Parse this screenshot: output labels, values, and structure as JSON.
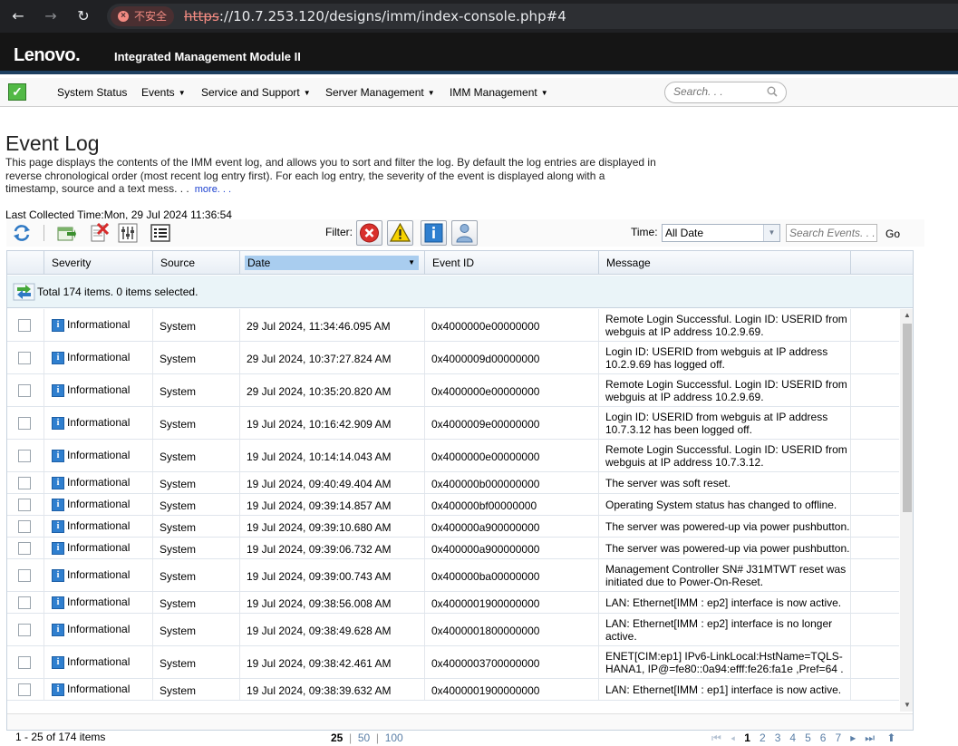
{
  "browser": {
    "insecure_label": "不安全",
    "url_scheme": "https",
    "url_rest": "://10.7.253.120/designs/imm/index-console.php#4"
  },
  "header": {
    "logo": "Lenovo.",
    "product": "Integrated Management Module II"
  },
  "menu": {
    "items": [
      "System Status",
      "Events",
      "Service and Support",
      "Server Management",
      "IMM Management"
    ],
    "search_placeholder": "Search. . ."
  },
  "page": {
    "title": "Event Log",
    "description": "This page displays the contents of the IMM event log, and allows you to sort and filter the log. By default the log entries are displayed in reverse chronological order (most recent log entry first). For each log entry, the severity of the event is displayed along with a timestamp, source and a text mess. . .",
    "more_link": "more. . .",
    "last_collected": "Last Collected Time:Mon, 29 Jul 2024 11:36:54"
  },
  "toolbar": {
    "filter_label": "Filter:",
    "time_label": "Time:",
    "time_value": "All Date",
    "search_events_placeholder": "Search Events. . .",
    "go_label": "Go"
  },
  "grid": {
    "columns": [
      "Severity",
      "Source",
      "Date",
      "Event ID",
      "Message"
    ],
    "sorted_column": "Date",
    "total_text": "Total 174 items. 0 items selected.",
    "rows": [
      {
        "severity": "Informational",
        "source": "System",
        "date": "29 Jul 2024, 11:34:46.095 AM",
        "event_id": "0x4000000e00000000",
        "message": "Remote Login Successful. Login ID: USERID from webguis at IP address 10.2.9.69."
      },
      {
        "severity": "Informational",
        "source": "System",
        "date": "29 Jul 2024, 10:37:27.824 AM",
        "event_id": "0x4000009d00000000",
        "message": "Login ID: USERID from webguis at IP address 10.2.9.69 has logged off."
      },
      {
        "severity": "Informational",
        "source": "System",
        "date": "29 Jul 2024, 10:35:20.820 AM",
        "event_id": "0x4000000e00000000",
        "message": "Remote Login Successful. Login ID: USERID from webguis at IP address 10.2.9.69."
      },
      {
        "severity": "Informational",
        "source": "System",
        "date": "19 Jul 2024, 10:16:42.909 AM",
        "event_id": "0x4000009e00000000",
        "message": "Login ID: USERID from webguis at IP address 10.7.3.12 has been logged off."
      },
      {
        "severity": "Informational",
        "source": "System",
        "date": "19 Jul 2024, 10:14:14.043 AM",
        "event_id": "0x4000000e00000000",
        "message": "Remote Login Successful. Login ID: USERID from webguis at IP address 10.7.3.12."
      },
      {
        "severity": "Informational",
        "source": "System",
        "date": "19 Jul 2024, 09:40:49.404 AM",
        "event_id": "0x400000b000000000",
        "message": "The server was soft reset."
      },
      {
        "severity": "Informational",
        "source": "System",
        "date": "19 Jul 2024, 09:39:14.857 AM",
        "event_id": "0x400000bf00000000",
        "message": "Operating System status has changed to offline."
      },
      {
        "severity": "Informational",
        "source": "System",
        "date": "19 Jul 2024, 09:39:10.680 AM",
        "event_id": "0x400000a900000000",
        "message": "The server was powered-up via power pushbutton."
      },
      {
        "severity": "Informational",
        "source": "System",
        "date": "19 Jul 2024, 09:39:06.732 AM",
        "event_id": "0x400000a900000000",
        "message": "The server was powered-up via power pushbutton."
      },
      {
        "severity": "Informational",
        "source": "System",
        "date": "19 Jul 2024, 09:39:00.743 AM",
        "event_id": "0x400000ba00000000",
        "message": "Management Controller SN# J31MTWT reset was initiated due to Power-On-Reset."
      },
      {
        "severity": "Informational",
        "source": "System",
        "date": "19 Jul 2024, 09:38:56.008 AM",
        "event_id": "0x4000001900000000",
        "message": "LAN: Ethernet[IMM : ep2] interface is now active."
      },
      {
        "severity": "Informational",
        "source": "System",
        "date": "19 Jul 2024, 09:38:49.628 AM",
        "event_id": "0x4000001800000000",
        "message": "LAN: Ethernet[IMM : ep2] interface is no longer active."
      },
      {
        "severity": "Informational",
        "source": "System",
        "date": "19 Jul 2024, 09:38:42.461 AM",
        "event_id": "0x4000003700000000",
        "message": "ENET[CIM:ep1] IPv6-LinkLocal:HstName=TQLS-HANA1, IP@=fe80::0a94:efff:fe26:fa1e ,Pref=64 ."
      },
      {
        "severity": "Informational",
        "source": "System",
        "date": "19 Jul 2024, 09:38:39.632 AM",
        "event_id": "0x4000001900000000",
        "message": "LAN: Ethernet[IMM : ep1] interface is now active."
      }
    ]
  },
  "pager": {
    "count_text": "1 - 25 of 174 items",
    "sizes": [
      "25",
      "50",
      "100"
    ],
    "pages": [
      "1",
      "2",
      "3",
      "4",
      "5",
      "6",
      "7"
    ]
  }
}
